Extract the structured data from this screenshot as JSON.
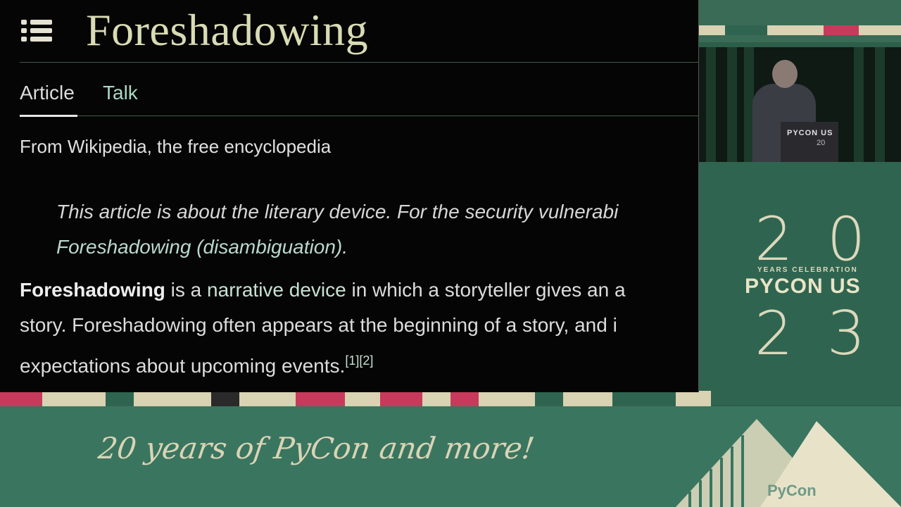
{
  "article": {
    "title": "Foreshadowing",
    "tabs": [
      {
        "label": "Article"
      },
      {
        "label": "Talk"
      }
    ],
    "tagline": "From Wikipedia, the free encyclopedia",
    "hatnote": {
      "line1": "This article is about the literary device. For the security vulnerabi",
      "link": "Foreshadowing (disambiguation)",
      "end": "."
    },
    "paragraph": {
      "term": "Foreshadowing",
      "line1_a": " is a ",
      "line1_link": "narrative device",
      "line1_b": " in which a storyteller gives an a",
      "line2": "story. Foreshadowing often appears at the beginning of a story, and i",
      "line3": "expectations about upcoming events.",
      "refs": "[1][2]"
    }
  },
  "video": {
    "podium_label": "PYCON US",
    "podium_number": "20"
  },
  "branding": {
    "year_top": "20",
    "years_label": "YEARS CELEBRATION",
    "event_name": "PYCON US",
    "year_bottom": "23",
    "slogan": "20 years of PyCon and more!",
    "footer_logo": "PyCon"
  },
  "colors": {
    "background_green": "#2c5e4a",
    "cream": "#dcd8bd",
    "accent_pink": "#c83a5c"
  }
}
